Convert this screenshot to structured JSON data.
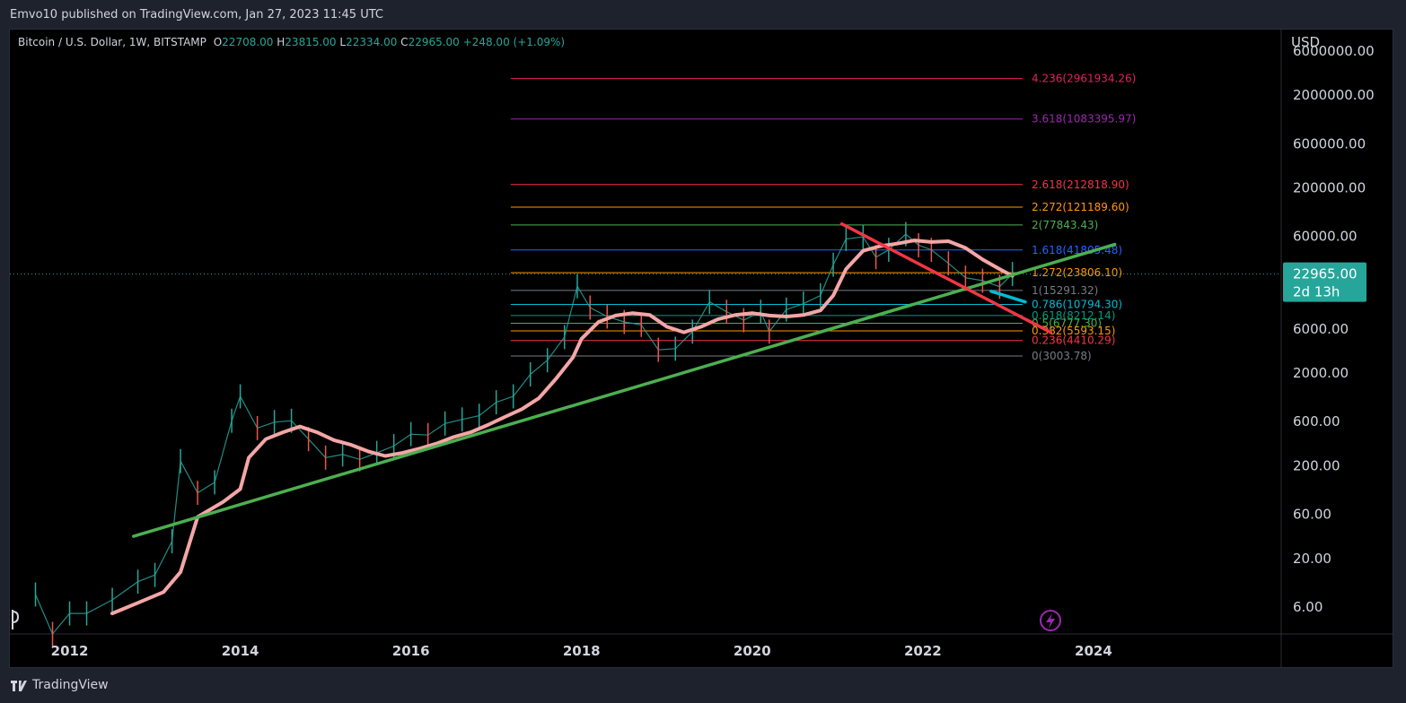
{
  "header": {
    "published": "Emvo10 published on TradingView.com, Jan 27, 2023 11:45 UTC"
  },
  "footer": {
    "brand": "TradingView"
  },
  "legend": {
    "symbol": "Bitcoin / U.S. Dollar, 1W, BITSTAMP",
    "o_label": "O",
    "o": "22708.00",
    "h_label": "H",
    "h": "23815.00",
    "l_label": "L",
    "l": "22334.00",
    "c_label": "C",
    "c": "22965.00",
    "change": "+248.00 (+1.09%)"
  },
  "chart_data": {
    "type": "line",
    "title": "",
    "currency": "USD",
    "y_scale": "log",
    "ylim": [
      3,
      10000000
    ],
    "xlim": [
      2011.3,
      2026.2
    ],
    "x_ticks": [
      "2012",
      "2014",
      "2016",
      "2018",
      "2020",
      "2022",
      "2024"
    ],
    "y_ticks": [
      {
        "label": "6000000.00",
        "value": 6000000
      },
      {
        "label": "2000000.00",
        "value": 2000000
      },
      {
        "label": "600000.00",
        "value": 600000
      },
      {
        "label": "200000.00",
        "value": 200000
      },
      {
        "label": "60000.00",
        "value": 60000
      },
      {
        "label": "6000.00",
        "value": 6000
      },
      {
        "label": "2000.00",
        "value": 2000
      },
      {
        "label": "600.00",
        "value": 600
      },
      {
        "label": "200.00",
        "value": 200
      },
      {
        "label": "60.00",
        "value": 60
      },
      {
        "label": "20.00",
        "value": 20
      },
      {
        "label": "6.00",
        "value": 6
      }
    ],
    "price_label": {
      "value": 22965,
      "text": "22965.00",
      "countdown": "2d 13h",
      "color": "#26a69a"
    },
    "fib_levels": [
      {
        "label": "4.236(2961934.26)",
        "value": 2961934.26,
        "color": "#e91e63"
      },
      {
        "label": "3.618(1083395.97)",
        "value": 1083395.97,
        "color": "#9c27b0"
      },
      {
        "label": "2.618(212818.90)",
        "value": 212818.9,
        "color": "#f23645"
      },
      {
        "label": "2.272(121189.60)",
        "value": 121189.6,
        "color": "#ff9800"
      },
      {
        "label": "2(77843.43)",
        "value": 77843.43,
        "color": "#4caf50"
      },
      {
        "label": "1.618(41805.48)",
        "value": 41805.48,
        "color": "#2962ff"
      },
      {
        "label": "1.272(23806.10)",
        "value": 23806.1,
        "color": "#ff9800"
      },
      {
        "label": "1(15291.32)",
        "value": 15291.32,
        "color": "#787b86"
      },
      {
        "label": "0.786(10794.30)",
        "value": 10794.3,
        "color": "#00bcd4"
      },
      {
        "label": "0.618(8212.14)",
        "value": 8212.14,
        "color": "#089981"
      },
      {
        "label": "0.5(6777.30)",
        "value": 6777.3,
        "color": "#4caf50"
      },
      {
        "label": "0.382(5593.15)",
        "value": 5593.15,
        "color": "#ff9800"
      },
      {
        "label": "0.236(4410.29)",
        "value": 4410.29,
        "color": "#f23645"
      },
      {
        "label": "0(3003.78)",
        "value": 3003.78,
        "color": "#787b86"
      }
    ],
    "fib_start_x": 2017.17,
    "fib_end_x": 2023.17,
    "trendlines": [
      {
        "color": "#4caf50",
        "points": [
          [
            2012.75,
            34
          ],
          [
            2024.25,
            48000
          ]
        ]
      },
      {
        "color": "#f23645",
        "points": [
          [
            2021.05,
            80000
          ],
          [
            2023.5,
            5400
          ]
        ]
      },
      {
        "color": "#00bcd4",
        "points": [
          [
            2022.8,
            15000
          ],
          [
            2023.2,
            11500
          ]
        ]
      }
    ],
    "moving_average": {
      "color": "#f4a6a6",
      "points": [
        [
          2012.5,
          5
        ],
        [
          2012.8,
          6.5
        ],
        [
          2013.1,
          8.5
        ],
        [
          2013.3,
          14
        ],
        [
          2013.5,
          55
        ],
        [
          2013.8,
          80
        ],
        [
          2014.0,
          110
        ],
        [
          2014.1,
          240
        ],
        [
          2014.3,
          380
        ],
        [
          2014.5,
          450
        ],
        [
          2014.7,
          520
        ],
        [
          2014.9,
          450
        ],
        [
          2015.1,
          370
        ],
        [
          2015.3,
          330
        ],
        [
          2015.5,
          280
        ],
        [
          2015.7,
          250
        ],
        [
          2015.9,
          270
        ],
        [
          2016.1,
          300
        ],
        [
          2016.3,
          340
        ],
        [
          2016.5,
          400
        ],
        [
          2016.7,
          450
        ],
        [
          2016.9,
          540
        ],
        [
          2017.1,
          660
        ],
        [
          2017.3,
          800
        ],
        [
          2017.5,
          1050
        ],
        [
          2017.7,
          1700
        ],
        [
          2017.9,
          2900
        ],
        [
          2018.0,
          4600
        ],
        [
          2018.2,
          7000
        ],
        [
          2018.4,
          8200
        ],
        [
          2018.6,
          8700
        ],
        [
          2018.8,
          8300
        ],
        [
          2019.0,
          6200
        ],
        [
          2019.2,
          5400
        ],
        [
          2019.4,
          6200
        ],
        [
          2019.6,
          7500
        ],
        [
          2019.8,
          8300
        ],
        [
          2020.0,
          8700
        ],
        [
          2020.2,
          8200
        ],
        [
          2020.4,
          8000
        ],
        [
          2020.6,
          8300
        ],
        [
          2020.8,
          9300
        ],
        [
          2020.95,
          13500
        ],
        [
          2021.1,
          26000
        ],
        [
          2021.3,
          41000
        ],
        [
          2021.5,
          46000
        ],
        [
          2021.7,
          49000
        ],
        [
          2021.9,
          53000
        ],
        [
          2022.1,
          51000
        ],
        [
          2022.3,
          52000
        ],
        [
          2022.5,
          44000
        ],
        [
          2022.7,
          33000
        ],
        [
          2022.9,
          26000
        ],
        [
          2023.05,
          22000
        ]
      ]
    },
    "series": [
      {
        "name": "",
        "points": [
          [
            2011.6,
            8
          ],
          [
            2011.8,
            3
          ],
          [
            2012.0,
            5
          ],
          [
            2012.2,
            5
          ],
          [
            2012.5,
            7
          ],
          [
            2012.8,
            11
          ],
          [
            2013.0,
            13
          ],
          [
            2013.2,
            30
          ],
          [
            2013.3,
            220
          ],
          [
            2013.5,
            100
          ],
          [
            2013.7,
            130
          ],
          [
            2013.9,
            600
          ],
          [
            2014.0,
            1100
          ],
          [
            2014.2,
            500
          ],
          [
            2014.4,
            580
          ],
          [
            2014.6,
            600
          ],
          [
            2014.8,
            380
          ],
          [
            2015.0,
            240
          ],
          [
            2015.2,
            260
          ],
          [
            2015.4,
            230
          ],
          [
            2015.6,
            270
          ],
          [
            2015.8,
            320
          ],
          [
            2016.0,
            430
          ],
          [
            2016.2,
            420
          ],
          [
            2016.4,
            560
          ],
          [
            2016.6,
            620
          ],
          [
            2016.8,
            680
          ],
          [
            2017.0,
            950
          ],
          [
            2017.2,
            1100
          ],
          [
            2017.4,
            1900
          ],
          [
            2017.6,
            2700
          ],
          [
            2017.8,
            4800
          ],
          [
            2017.95,
            17000
          ],
          [
            2018.1,
            10000
          ],
          [
            2018.3,
            8000
          ],
          [
            2018.5,
            7000
          ],
          [
            2018.7,
            6500
          ],
          [
            2018.9,
            3500
          ],
          [
            2019.1,
            3600
          ],
          [
            2019.3,
            5500
          ],
          [
            2019.5,
            11500
          ],
          [
            2019.7,
            9000
          ],
          [
            2019.9,
            7300
          ],
          [
            2020.1,
            9000
          ],
          [
            2020.2,
            5500
          ],
          [
            2020.4,
            9500
          ],
          [
            2020.6,
            11000
          ],
          [
            2020.8,
            13500
          ],
          [
            2020.95,
            29000
          ],
          [
            2021.1,
            55000
          ],
          [
            2021.3,
            58000
          ],
          [
            2021.45,
            35000
          ],
          [
            2021.6,
            42000
          ],
          [
            2021.8,
            62000
          ],
          [
            2021.95,
            47000
          ],
          [
            2022.1,
            42000
          ],
          [
            2022.3,
            30000
          ],
          [
            2022.5,
            21000
          ],
          [
            2022.7,
            19500
          ],
          [
            2022.9,
            16800
          ],
          [
            2023.05,
            23000
          ]
        ]
      }
    ]
  }
}
